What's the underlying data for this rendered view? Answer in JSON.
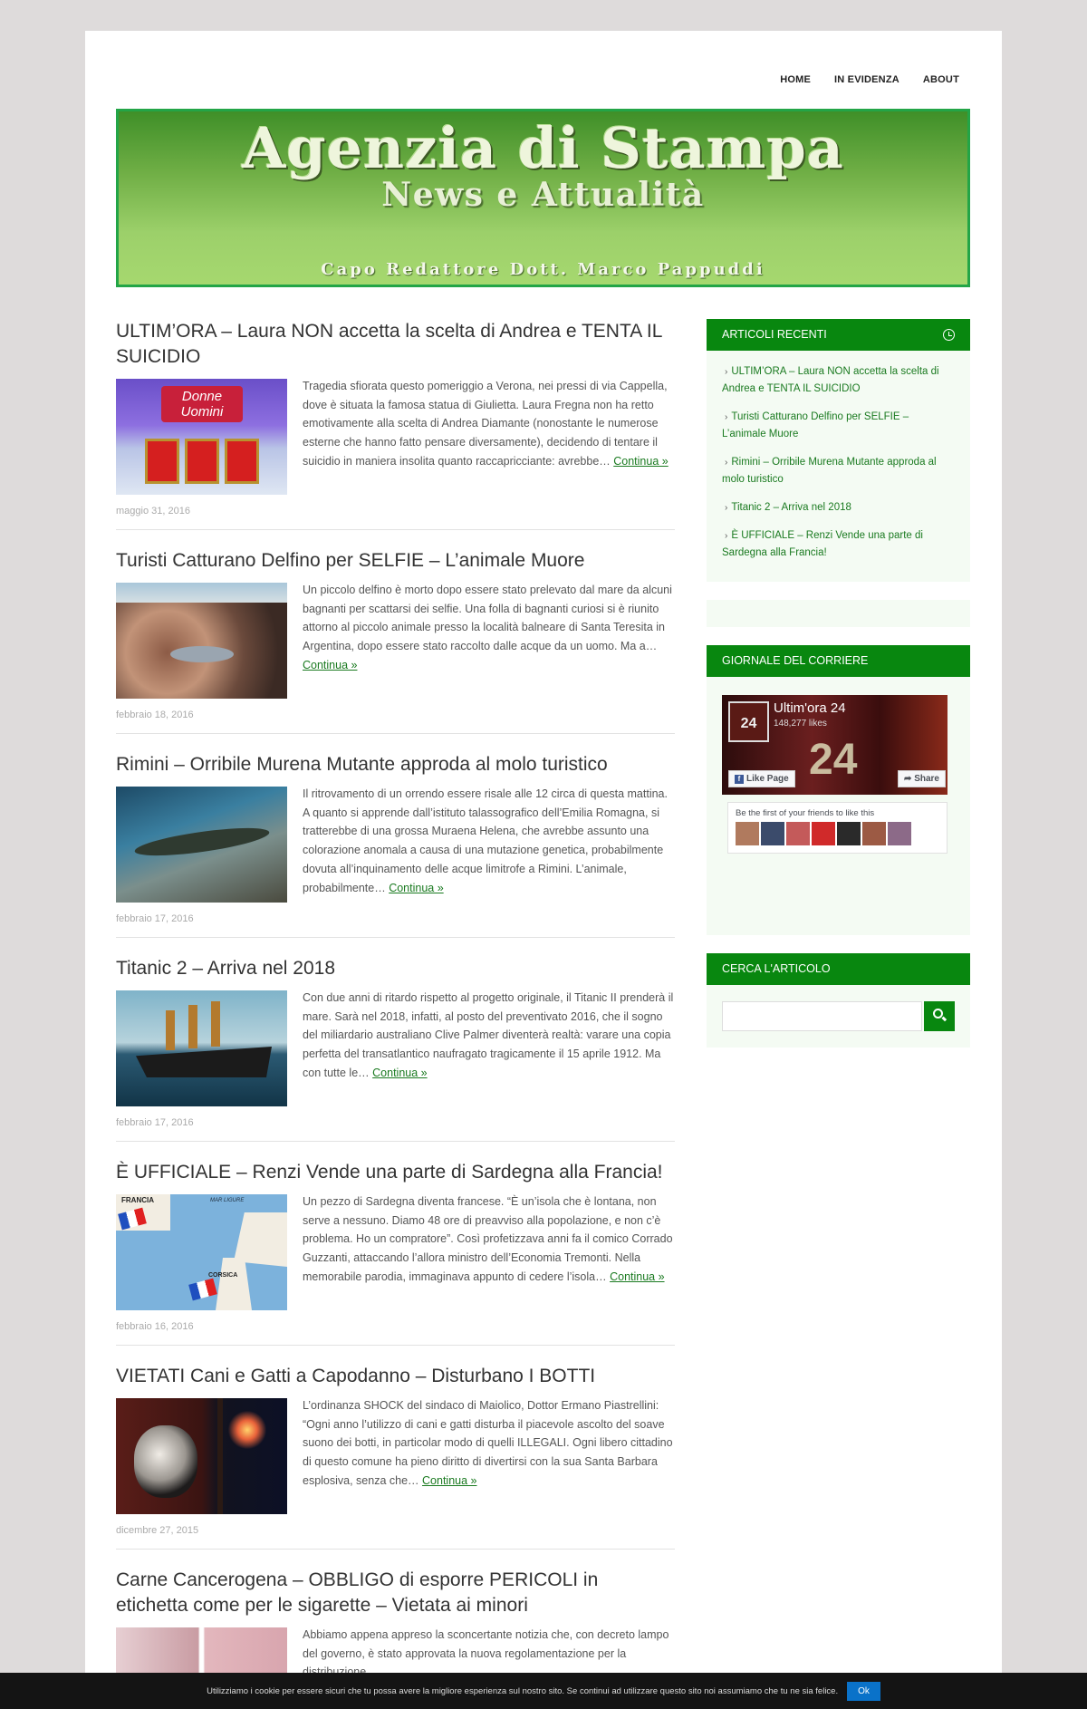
{
  "nav": {
    "home": "HOME",
    "evidenza": "IN EVIDENZA",
    "about": "ABOUT"
  },
  "banner": {
    "title": "Agenzia di Stampa",
    "subtitle": "News e Attualità",
    "editor": "Capo Redattore Dott. Marco Pappuddi"
  },
  "more_label": "Continua »",
  "posts": [
    {
      "title": "ULTIM’ORA – Laura NON accetta la scelta di Andrea e TENTA IL SUICIDIO",
      "excerpt": "Tragedia sfiorata questo pomeriggio a Verona, nei pressi di via Cappella, dove è situata la famosa statua di Giulietta. Laura Fregna non ha retto emotivamente alla scelta di Andrea Diamante (nonostante le numerose esterne che hanno fatto pensare diversamente), decidendo di tentare il suicidio in maniera insolita quanto raccapricciante: avrebbe…",
      "date": "maggio 31, 2016",
      "thumb_text": "Donne Uomini"
    },
    {
      "title": "Turisti Catturano Delfino per SELFIE – L’animale Muore",
      "excerpt": "Un piccolo delfino è morto dopo essere stato prelevato dal mare da alcuni bagnanti per scattarsi dei selfie. Una folla di bagnanti curiosi si è riunito attorno al piccolo animale presso la località balneare di Santa Teresita in Argentina, dopo essere stato raccolto dalle acque da un uomo. Ma a…",
      "date": "febbraio 18, 2016"
    },
    {
      "title": "Rimini – Orribile Murena Mutante approda al molo turistico",
      "excerpt": "Il ritrovamento di un orrendo essere risale alle 12 circa di questa mattina. A quanto si apprende dall’istituto talassografico dell’Emilia Romagna, si tratterebbe di una grossa Muraena Helena, che avrebbe assunto una colorazione anomala a causa di una mutazione genetica, probabilmente dovuta all’inquinamento delle acque limitrofe a Rimini. L’animale, probabilmente…",
      "date": "febbraio 17, 2016"
    },
    {
      "title": "Titanic 2 – Arriva nel 2018",
      "excerpt": "Con due anni di ritardo rispetto al progetto originale, il Titanic II prenderà il mare. Sarà nel 2018, infatti, al posto del preventivato 2016, che il sogno del miliardario australiano Clive Palmer diventerà realtà: varare una copia perfetta del transatlantico naufragato tragicamente il 15 aprile 1912. Ma con tutte le…",
      "date": "febbraio 17, 2016"
    },
    {
      "title": "È UFFICIALE – Renzi Vende una parte di Sardegna alla Francia!",
      "excerpt": "Un pezzo di Sardegna diventa francese. “È un’isola che è lontana, non serve a nessuno. Diamo 48 ore di preavviso alla popolazione, e non c’è problema. Ho un compratore”. Così profetizzava anni fa il comico Corrado Guzzanti, attaccando l’allora ministro dell’Economia Tremonti. Nella memorabile parodia, immaginava appunto di cedere l’isola…",
      "date": "febbraio 16, 2016",
      "map_labels": [
        "FRANCIA",
        "MAR LIGURE",
        "CORSICA"
      ]
    },
    {
      "title": "VIETATI Cani e Gatti a Capodanno – Disturbano I BOTTI",
      "excerpt": "L’ordinanza SHOCK del sindaco di Maiolico, Dottor Ermano Piastrellini: “Ogni anno l’utilizzo di cani e gatti disturba il piacevole  ascolto del soave suono dei botti, in particolar modo di quelli ILLEGALI. Ogni libero cittadino di questo comune ha pieno diritto di divertirsi con la sua Santa Barbara esplosiva, senza che…",
      "date": "dicembre 27, 2015"
    },
    {
      "title": "Carne Cancerogena – OBBLIGO di esporre PERICOLI in etichetta come per le sigarette – Vietata ai minori",
      "excerpt": "Abbiamo appena appreso la sconcertante notizia che, con decreto lampo del governo, è stato approvata la nuova regolamentazione per la distribuzione",
      "date": ""
    }
  ],
  "sidebar": {
    "recent_title": "ARTICOLI RECENTI",
    "recent": [
      "ULTIM’ORA – Laura NON accetta la scelta di Andrea e TENTA IL SUICIDIO",
      "Turisti Catturano Delfino per SELFIE – L’animale Muore",
      "Rimini – Orribile Murena Mutante approda al molo turistico",
      "Titanic 2 – Arriva nel 2018",
      "È UFFICIALE – Renzi Vende una parte di Sardegna alla Francia!"
    ],
    "giornale_title": "GIORNALE DEL CORRIERE",
    "fb": {
      "page_name": "Ultim'ora 24",
      "likes": "148,277 likes",
      "like_btn": "Like Page",
      "share_btn": "Share",
      "friends_text": "Be the first of your friends to like this",
      "logo_text": "24",
      "cover_text": "24"
    },
    "search_title": "CERCA L'ARTICOLO"
  },
  "cookie": {
    "message": "Utilizziamo i cookie per essere sicuri che tu possa avere la migliore esperienza sul nostro sito. Se continui ad utilizzare questo sito noi assumiamo che tu ne sia felice.",
    "ok": "Ok"
  }
}
